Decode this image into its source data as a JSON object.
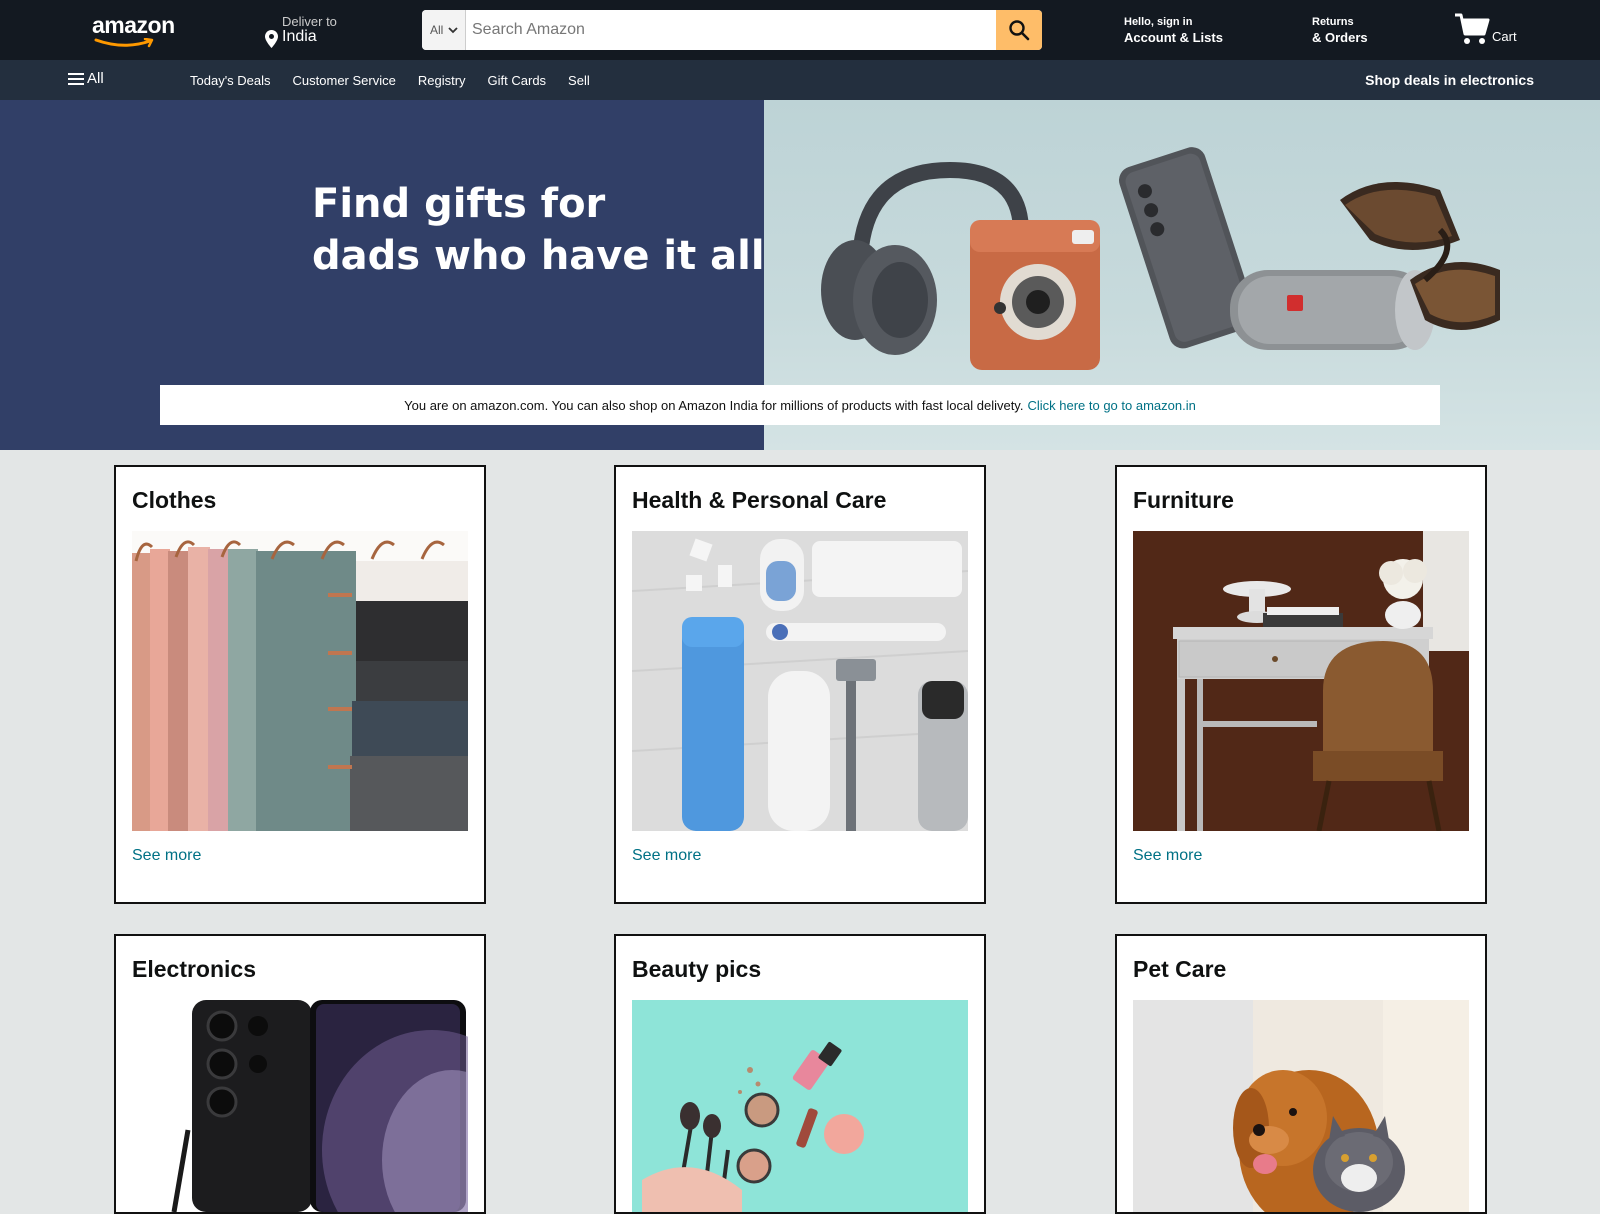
{
  "header": {
    "logo": "amazon",
    "deliver_label": "Deliver to",
    "deliver_value": "India",
    "search": {
      "category": "All",
      "placeholder": "Search Amazon",
      "value": ""
    },
    "account_line1": "Hello, sign in",
    "account_line2": "Account & Lists",
    "returns_line1": "Returns",
    "returns_line2": "& Orders",
    "cart_label": "Cart"
  },
  "subnav": {
    "all_label": "All",
    "links": [
      "Today's Deals",
      "Customer Service",
      "Registry",
      "Gift Cards",
      "Sell"
    ],
    "promo": "Shop deals in electronics"
  },
  "hero": {
    "title_line1": "Find gifts for",
    "title_line2": "dads who have it all"
  },
  "notice": {
    "text": "You are on amazon.com. You can also shop on Amazon India for millions of products with fast local delivety.",
    "link": "Click here to go to amazon.in"
  },
  "cards": [
    {
      "title": "Clothes",
      "link": "See more",
      "image": "clothes-image"
    },
    {
      "title": "Health & Personal Care",
      "link": "See more",
      "image": "health-image"
    },
    {
      "title": "Furniture",
      "link": "See more",
      "image": "furniture-image"
    },
    {
      "title": "Electronics",
      "link": "",
      "image": "electronics-image"
    },
    {
      "title": "Beauty pics",
      "link": "",
      "image": "beauty-image"
    },
    {
      "title": "Pet Care",
      "link": "",
      "image": "pet-image"
    }
  ],
  "colors": {
    "nav_top": "#131921",
    "nav_sub": "#232f3e",
    "search_button": "#febd69",
    "link": "#007185",
    "hero_left": "#313f67",
    "page_bg": "#e3e6e6"
  }
}
